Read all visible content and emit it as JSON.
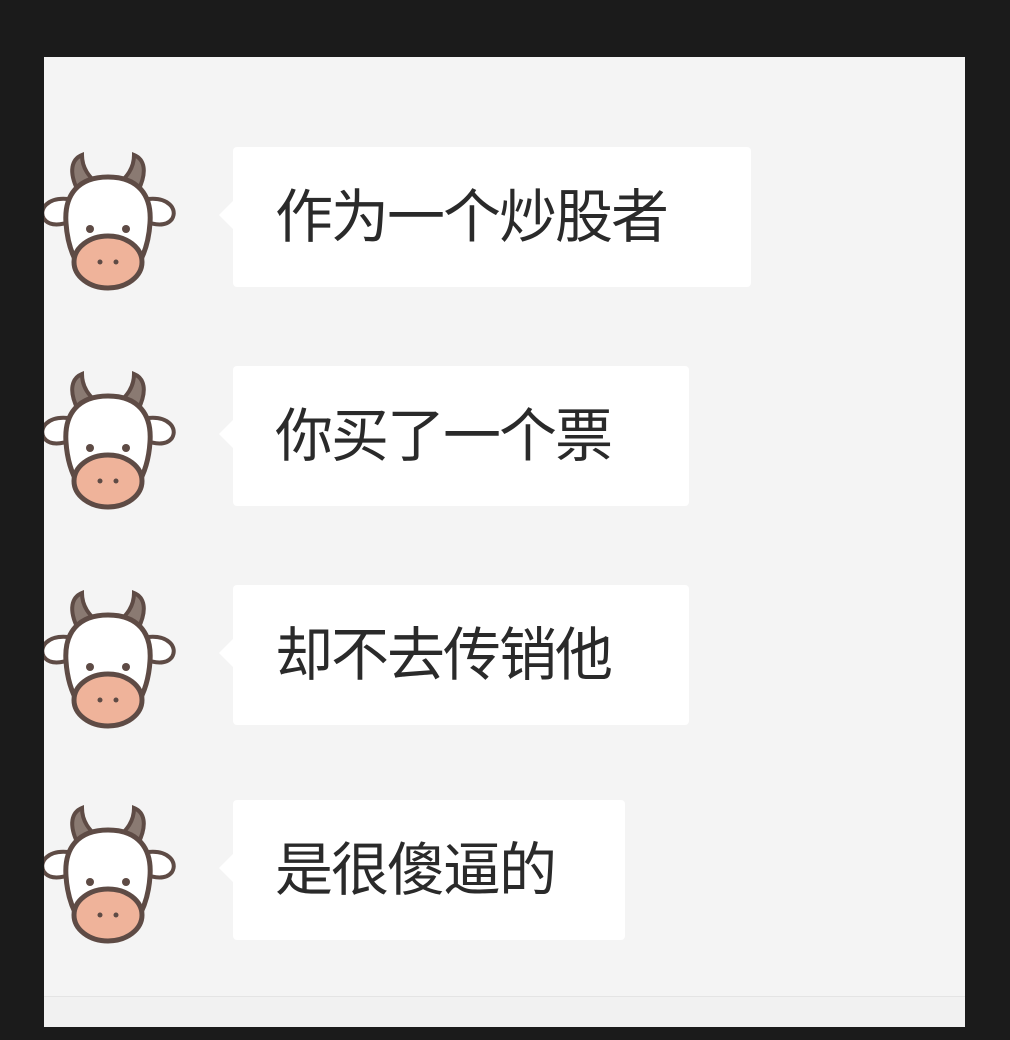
{
  "chat": {
    "messages": [
      {
        "text": "作为一个炒股者",
        "avatar_icon": "cow-icon"
      },
      {
        "text": "你买了一个票",
        "avatar_icon": "cow-icon"
      },
      {
        "text": "却不去传销他",
        "avatar_icon": "cow-icon"
      },
      {
        "text": "是很傻逼的",
        "avatar_icon": "cow-icon"
      }
    ]
  },
  "colors": {
    "frame": "#1b1b1b",
    "panel": "#f4f4f4",
    "bubble": "#ffffff",
    "cow_nose": "#efb39a",
    "cow_outline": "#5e4b45"
  }
}
